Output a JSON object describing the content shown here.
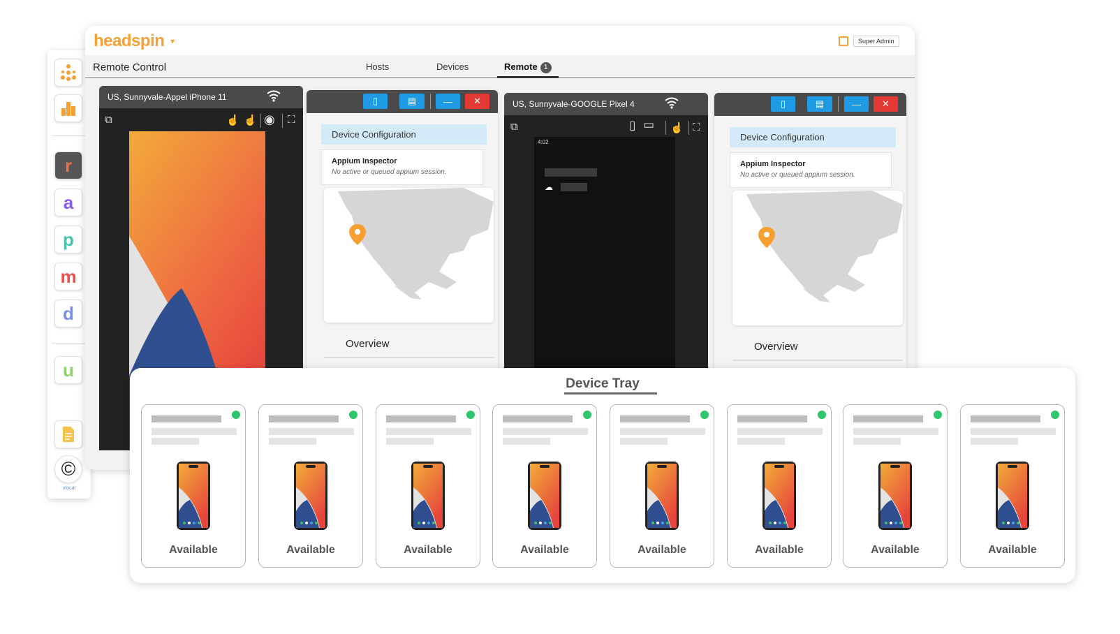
{
  "app": {
    "logo": "headspin",
    "logo_caret": "▾",
    "user_badge": "Super Admin",
    "page_title": "Remote Control"
  },
  "nav": {
    "tabs": [
      {
        "label": "Hosts"
      },
      {
        "label": "Devices"
      },
      {
        "label": "Remote",
        "badge": "1"
      }
    ]
  },
  "sidebar": {
    "items": [
      {
        "icon": "network-icon",
        "color": "#f5a031"
      },
      {
        "icon": "bar-chart-icon",
        "color": "#f5a031"
      },
      {
        "icon": "r-app-icon",
        "glyph": "r",
        "color": "#e8734a"
      },
      {
        "icon": "a-app-icon",
        "glyph": "a",
        "color": "#8a5cf6"
      },
      {
        "icon": "p-app-icon",
        "glyph": "p",
        "color": "#45c4b0"
      },
      {
        "icon": "m-app-icon",
        "glyph": "m",
        "color": "#f04e4e"
      },
      {
        "icon": "d-app-icon",
        "glyph": "d",
        "color": "#7a8de8"
      },
      {
        "icon": "u-app-icon",
        "glyph": "u",
        "color": "#8ed06a"
      },
      {
        "icon": "document-icon",
        "color": "#f5c34a"
      },
      {
        "icon": "copyright-icon",
        "glyph": "©",
        "color": "#222222"
      }
    ],
    "brand": "vlocal"
  },
  "devices": [
    {
      "name": "US, Sunnyvale-Appel iPhone 11"
    },
    {
      "name": "US, Sunnyvale-GOOGLE Pixel 4",
      "clock": "4:02"
    }
  ],
  "config_panels": [
    {
      "section_title": "Device Configuration",
      "inspector_title": "Appium Inspector",
      "inspector_status": "No active or queued appium session.",
      "overview_label": "Overview"
    },
    {
      "section_title": "Device Configuration",
      "inspector_title": "Appium Inspector",
      "inspector_status": "No active or queued appium session.",
      "overview_label": "Overview"
    }
  ],
  "tray": {
    "title": "Device Tray",
    "cards": [
      {
        "status": "Available"
      },
      {
        "status": "Available"
      },
      {
        "status": "Available"
      },
      {
        "status": "Available"
      },
      {
        "status": "Available"
      },
      {
        "status": "Available"
      },
      {
        "status": "Available"
      },
      {
        "status": "Available"
      }
    ]
  },
  "colors": {
    "brand": "#f5a031",
    "tab_blue": "#1f9be6",
    "close_red": "#e53935",
    "available_green": "#2ec66a"
  }
}
